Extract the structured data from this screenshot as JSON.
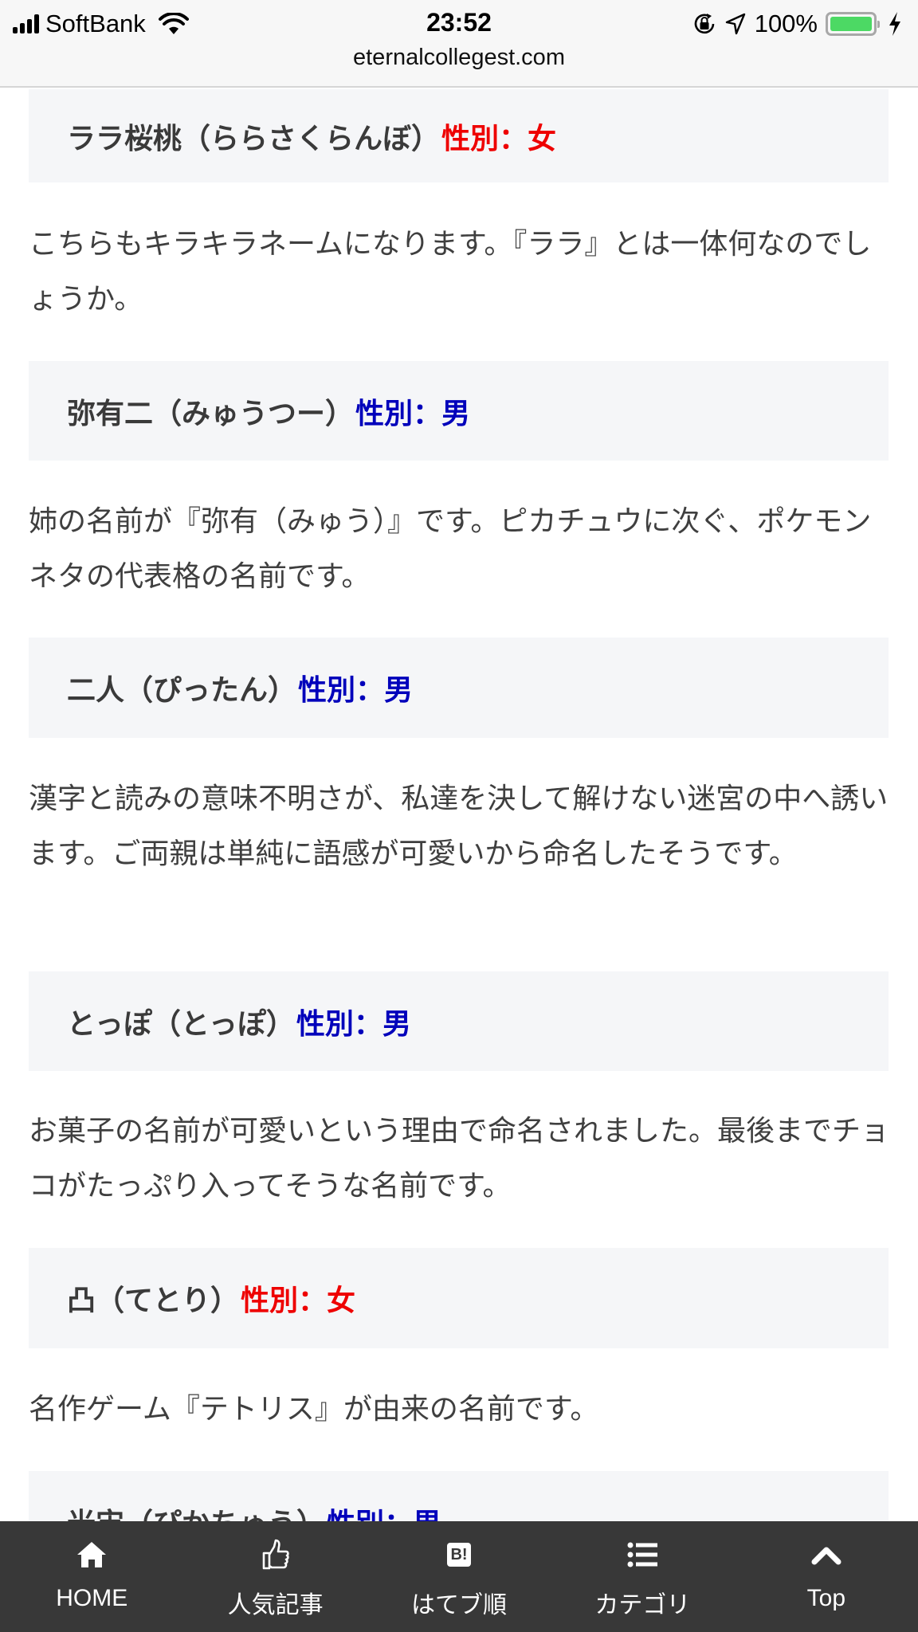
{
  "status_bar": {
    "carrier": "SoftBank",
    "time": "23:52",
    "battery_percent_label": "100%",
    "battery_level": 1.0,
    "icons": [
      "signal-icon",
      "wifi-icon",
      "rotation-lock-icon",
      "location-arrow-icon",
      "battery-icon",
      "charging-bolt-icon"
    ]
  },
  "browser": {
    "url": "eternalcollegest.com"
  },
  "colors": {
    "female": "#ee0000",
    "male": "#0000bb",
    "heading_bg": "#f5f6f8",
    "nav_bg": "#383838",
    "battery_fill": "#4cd964"
  },
  "entries": [
    {
      "name": "ララ桜桃（ららさくらんぼ）",
      "gender": "性別：女",
      "gender_type": "female",
      "description": "こちらもキラキラネームになります。『ララ』とは一体何なのでしょうか。"
    },
    {
      "name": "弥有二（みゅうつー）",
      "gender": "性別：男",
      "gender_type": "male",
      "description": "姉の名前が『弥有（みゅう）』です。ピカチュウに次ぐ、ポケモンネタの代表格の名前です。"
    },
    {
      "name": "二人（ぴったん）",
      "gender": "性別：男",
      "gender_type": "male",
      "description": "漢字と読みの意味不明さが、私達を決して解けない迷宮の中へ誘います。ご両親は単純に語感が可愛いから命名したそうです。"
    },
    {
      "name": "とっぽ（とっぽ）",
      "gender": "性別：男",
      "gender_type": "male",
      "description": "お菓子の名前が可愛いという理由で命名されました。最後までチョコがたっぷり入ってそうな名前です。"
    },
    {
      "name": "凸（てとり）",
      "gender": "性別：女",
      "gender_type": "female",
      "description": "名作ゲーム『テトリス』が由来の名前です。"
    },
    {
      "name": "光宙（ぴかちゅう）",
      "gender": "性別：男",
      "gender_type": "male",
      "description": ""
    }
  ],
  "bottom_nav": [
    {
      "label": "HOME",
      "icon": "home-icon"
    },
    {
      "label": "人気記事",
      "icon": "thumbs-up-icon"
    },
    {
      "label": "はてブ順",
      "icon": "hatena-bookmark-icon",
      "icon_text": "B!"
    },
    {
      "label": "カテゴリ",
      "icon": "list-icon"
    },
    {
      "label": "Top",
      "icon": "chevron-up-icon"
    }
  ]
}
